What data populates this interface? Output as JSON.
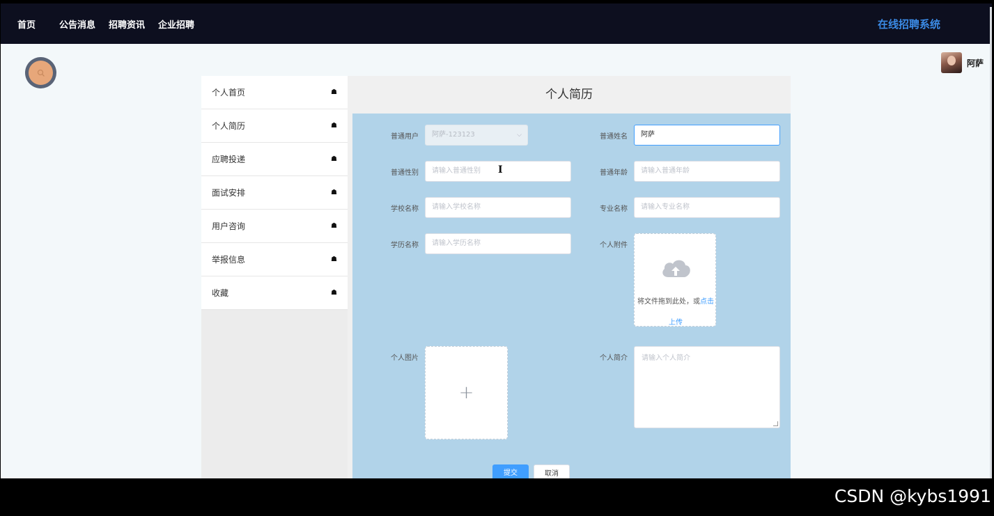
{
  "nav": {
    "items": [
      "首页",
      "公告消息",
      "招聘资讯",
      "企业招聘"
    ],
    "brand": "在线招聘系统"
  },
  "user": {
    "name": "阿萨"
  },
  "sidebar": {
    "items": [
      {
        "label": "个人首页",
        "icon": "home-icon"
      },
      {
        "label": "个人简历",
        "icon": "home-icon"
      },
      {
        "label": "应聘投递",
        "icon": "home-icon"
      },
      {
        "label": "面试安排",
        "icon": "home-icon"
      },
      {
        "label": "用户咨询",
        "icon": "home-icon"
      },
      {
        "label": "举报信息",
        "icon": "home-icon"
      },
      {
        "label": "收藏",
        "icon": "home-icon"
      }
    ]
  },
  "panel": {
    "title": "个人简历"
  },
  "form": {
    "user_label": "普通用户",
    "user_value": "阿萨-123123",
    "name_label": "普通姓名",
    "name_value": "阿萨",
    "gender_label": "普通性别",
    "gender_placeholder": "请输入普通性别",
    "age_label": "普通年龄",
    "age_placeholder": "请输入普通年龄",
    "school_label": "学校名称",
    "school_placeholder": "请输入学校名称",
    "major_label": "专业名称",
    "major_placeholder": "请输入专业名称",
    "degree_label": "学历名称",
    "degree_placeholder": "请输入学历名称",
    "attachment_label": "个人附件",
    "upload_text": "将文件拖到此处，或",
    "upload_link": "点击",
    "upload_link2": "上传",
    "photo_label": "个人图片",
    "photo_plus": "+",
    "intro_label": "个人简介",
    "intro_placeholder": "请输入个人简介",
    "submit_label": "提交",
    "cancel_label": "取消"
  },
  "watermark": "CSDN @kybs1991",
  "colors": {
    "nav_bg": "#0d0f1f",
    "brand": "#3b8be6",
    "form_bg": "#b1d3e9",
    "primary": "#409eff"
  }
}
